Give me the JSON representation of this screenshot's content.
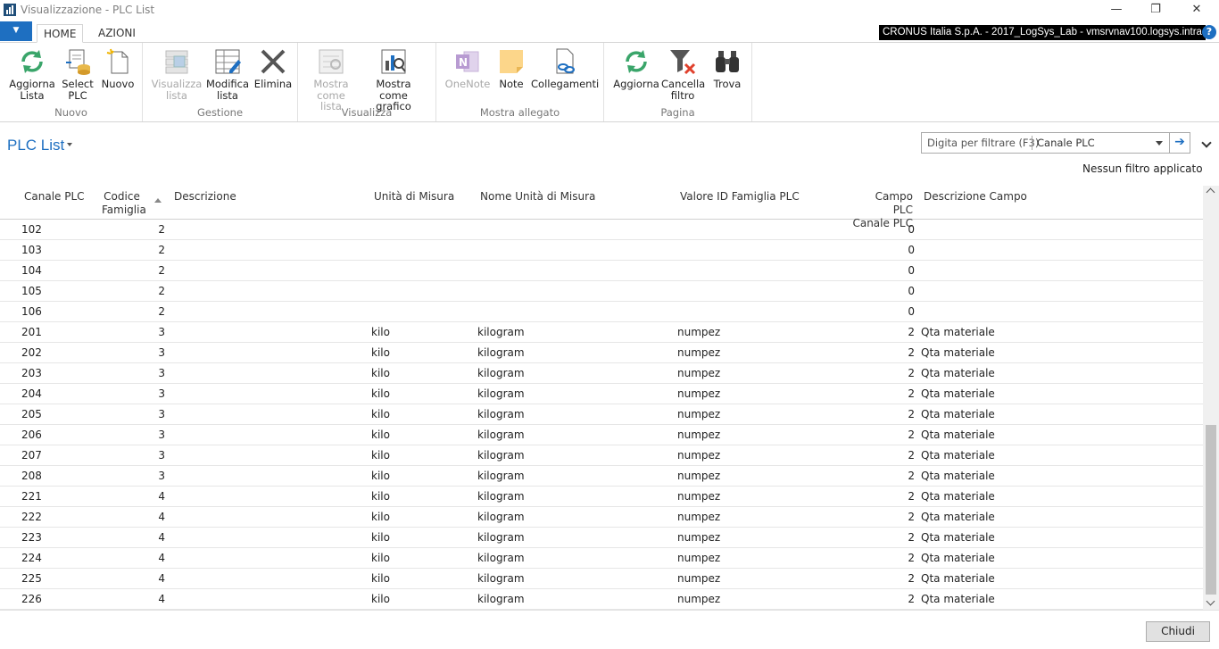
{
  "window": {
    "title": "Visualizzazione - PLC List",
    "minimize": "—",
    "restore": "❐",
    "close": "✕"
  },
  "ribbon_tabs": {
    "file_glyph": "▼",
    "home": "HOME",
    "actions": "AZIONI"
  },
  "company": "CRONUS Italia S.p.A. - 2017_LogSys_Lab - vmsrvnav100.logsys.intra",
  "help_glyph": "?",
  "ribbon": {
    "groups": {
      "nuovo": "Nuovo",
      "gestione": "Gestione",
      "visualizza": "Visualizza",
      "mostra_allegato": "Mostra allegato",
      "pagina": "Pagina"
    },
    "buttons": {
      "aggiorna_lista": [
        "Aggiorna",
        "Lista"
      ],
      "select_plc": [
        "Select",
        "PLC"
      ],
      "nuovo": [
        "Nuovo"
      ],
      "visualizza_lista": [
        "Visualizza",
        "lista"
      ],
      "modifica_lista": [
        "Modifica",
        "lista"
      ],
      "elimina": [
        "Elimina"
      ],
      "mostra_come_lista": [
        "Mostra",
        "come lista"
      ],
      "mostra_come_grafico": [
        "Mostra come",
        "grafico"
      ],
      "onenote": [
        "OneNote"
      ],
      "note": [
        "Note"
      ],
      "collegamenti": [
        "Collegamenti"
      ],
      "aggiorna": [
        "Aggiorna"
      ],
      "cancella_filtro": [
        "Cancella",
        "filtro"
      ],
      "trova": [
        "Trova"
      ]
    }
  },
  "page": {
    "title": "PLC List",
    "filter_placeholder": "Digita per filtrare (F3)",
    "filter_field": "Canale PLC",
    "filter_go": "➔",
    "no_filter": "Nessun filtro applicato"
  },
  "table": {
    "headers": {
      "canale_plc": "Canale PLC",
      "codice_famiglia": [
        "Codice",
        "Famiglia"
      ],
      "descrizione": "Descrizione",
      "unita_misura": "Unità di Misura",
      "nome_unita_misura": "Nome Unità di Misura",
      "valore_id_famiglia": "Valore ID Famiglia PLC",
      "campo_plc_canale": [
        "Campo PLC",
        "Canale PLC"
      ],
      "descrizione_campo": "Descrizione Campo"
    },
    "rows": [
      [
        "102",
        "2",
        "",
        "",
        "",
        "",
        "0",
        ""
      ],
      [
        "103",
        "2",
        "",
        "",
        "",
        "",
        "0",
        ""
      ],
      [
        "104",
        "2",
        "",
        "",
        "",
        "",
        "0",
        ""
      ],
      [
        "105",
        "2",
        "",
        "",
        "",
        "",
        "0",
        ""
      ],
      [
        "106",
        "2",
        "",
        "",
        "",
        "",
        "0",
        ""
      ],
      [
        "201",
        "3",
        "",
        "kilo",
        "kilogram",
        "numpez",
        "2",
        "Qta materiale"
      ],
      [
        "202",
        "3",
        "",
        "kilo",
        "kilogram",
        "numpez",
        "2",
        "Qta materiale"
      ],
      [
        "203",
        "3",
        "",
        "kilo",
        "kilogram",
        "numpez",
        "2",
        "Qta materiale"
      ],
      [
        "204",
        "3",
        "",
        "kilo",
        "kilogram",
        "numpez",
        "2",
        "Qta materiale"
      ],
      [
        "205",
        "3",
        "",
        "kilo",
        "kilogram",
        "numpez",
        "2",
        "Qta materiale"
      ],
      [
        "206",
        "3",
        "",
        "kilo",
        "kilogram",
        "numpez",
        "2",
        "Qta materiale"
      ],
      [
        "207",
        "3",
        "",
        "kilo",
        "kilogram",
        "numpez",
        "2",
        "Qta materiale"
      ],
      [
        "208",
        "3",
        "",
        "kilo",
        "kilogram",
        "numpez",
        "2",
        "Qta materiale"
      ],
      [
        "221",
        "4",
        "",
        "kilo",
        "kilogram",
        "numpez",
        "2",
        "Qta materiale"
      ],
      [
        "222",
        "4",
        "",
        "kilo",
        "kilogram",
        "numpez",
        "2",
        "Qta materiale"
      ],
      [
        "223",
        "4",
        "",
        "kilo",
        "kilogram",
        "numpez",
        "2",
        "Qta materiale"
      ],
      [
        "224",
        "4",
        "",
        "kilo",
        "kilogram",
        "numpez",
        "2",
        "Qta materiale"
      ],
      [
        "225",
        "4",
        "",
        "kilo",
        "kilogram",
        "numpez",
        "2",
        "Qta materiale"
      ],
      [
        "226",
        "4",
        "",
        "kilo",
        "kilogram",
        "numpez",
        "2",
        "Qta materiale"
      ]
    ]
  },
  "footer": {
    "close_label": "Chiudi"
  },
  "colors": {
    "accent": "#1e6fc1",
    "company_bar": "#000000"
  }
}
